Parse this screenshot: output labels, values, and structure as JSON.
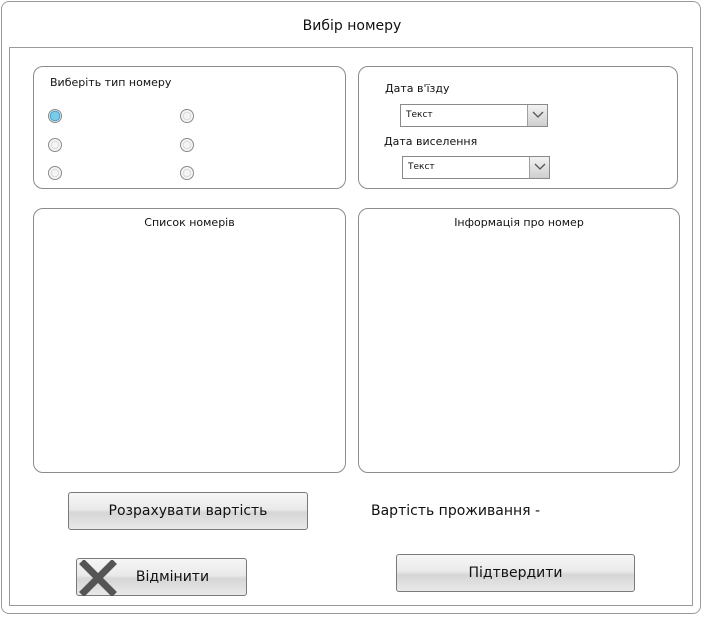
{
  "window": {
    "title": "Вибір номеру"
  },
  "room_type": {
    "label": "Виберіть тип номеру",
    "options": [
      {
        "selected": true
      },
      {
        "selected": false
      },
      {
        "selected": false
      },
      {
        "selected": false
      },
      {
        "selected": false
      },
      {
        "selected": false
      }
    ]
  },
  "dates": {
    "checkin_label": "Дата в'їзду",
    "checkin_value": "Текст",
    "checkout_label": "Дата виселення",
    "checkout_value": "Текст"
  },
  "room_list": {
    "label": "Список номерів"
  },
  "room_info": {
    "label": "Інформація про номер"
  },
  "actions": {
    "calculate_label": "Розрахувати вартість",
    "cost_label": "Вартість проживання -",
    "cancel_label": "Відмінити",
    "confirm_label": "Підтвердити"
  },
  "colors": {
    "radio_selected": "#79cdea",
    "border": "#8c8c8c"
  },
  "icons": {
    "cancel": "close-x-icon",
    "dropdown": "chevron-down-icon"
  }
}
